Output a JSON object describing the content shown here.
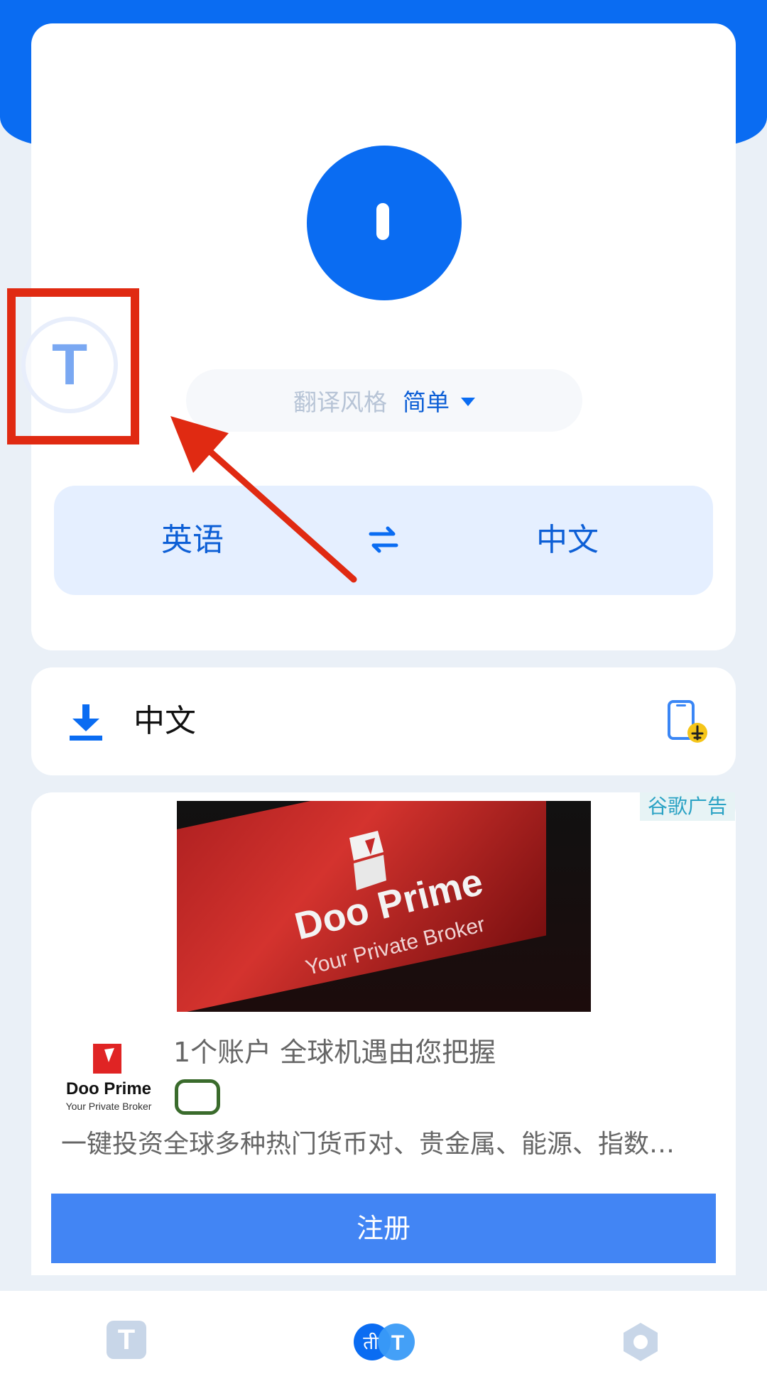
{
  "main": {
    "floating_button_label": "T",
    "style_label": "翻译风格",
    "style_value": "简单",
    "source_language": "英语",
    "target_language": "中文"
  },
  "output": {
    "language": "中文"
  },
  "ad": {
    "tag": "谷歌广告",
    "image_brand": "Doo Prime",
    "image_tagline": "Your Private Broker",
    "logo_name": "Doo Prime",
    "logo_tagline": "Your Private Broker",
    "headline": "1个账户 全球机遇由您把握",
    "description": "一键投资全球多种热门货币对、贵金属、能源、指数…",
    "cta": "注册"
  },
  "bottom_nav": {
    "text_tab_label": "T",
    "translate_tab_label_left": "ती",
    "translate_tab_label_right": "T"
  },
  "colors": {
    "primary": "#0a6cf2",
    "annotation_red": "#e02a12",
    "ad_cta": "#4285f4"
  },
  "icons": [
    "mic-icon",
    "swap-icon",
    "download-icon",
    "phone-airplane-icon",
    "text-tab-icon",
    "translate-tab-icon",
    "settings-hexagon-icon"
  ]
}
